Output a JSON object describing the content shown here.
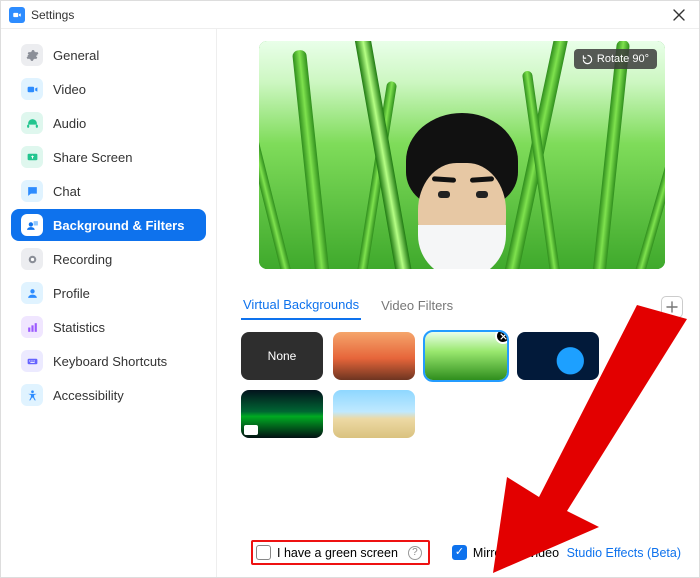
{
  "window": {
    "title": "Settings"
  },
  "sidebar": {
    "items": [
      {
        "id": "general",
        "label": "General"
      },
      {
        "id": "video",
        "label": "Video"
      },
      {
        "id": "audio",
        "label": "Audio"
      },
      {
        "id": "share-screen",
        "label": "Share Screen"
      },
      {
        "id": "chat",
        "label": "Chat"
      },
      {
        "id": "bg-filters",
        "label": "Background & Filters"
      },
      {
        "id": "recording",
        "label": "Recording"
      },
      {
        "id": "profile",
        "label": "Profile"
      },
      {
        "id": "statistics",
        "label": "Statistics"
      },
      {
        "id": "kb-shortcuts",
        "label": "Keyboard Shortcuts"
      },
      {
        "id": "accessibility",
        "label": "Accessibility"
      }
    ],
    "active_index": 5
  },
  "preview": {
    "rotate_label": "Rotate 90°"
  },
  "tabs": {
    "items": [
      {
        "id": "virtual-backgrounds",
        "label": "Virtual Backgrounds"
      },
      {
        "id": "video-filters",
        "label": "Video Filters"
      }
    ],
    "active_index": 0
  },
  "thumbnails": {
    "none_label": "None",
    "selected_index": 2,
    "items": [
      "none",
      "bridge",
      "grass",
      "earth",
      "aurora",
      "beach"
    ]
  },
  "options": {
    "green_screen": {
      "label": "I have a green screen",
      "checked": false
    },
    "mirror": {
      "label": "Mirror my video",
      "checked": true
    }
  },
  "studio_effects_label": "Studio Effects (Beta)",
  "colors": {
    "accent": "#0e72ed",
    "highlight": "#e11"
  }
}
